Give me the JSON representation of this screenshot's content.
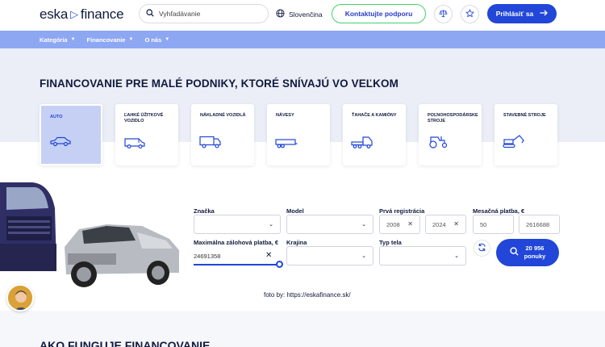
{
  "header": {
    "logo_left": "eska",
    "logo_right": "finance",
    "search_placeholder": "Vyhľadávanie",
    "language": "Slovenčina",
    "contact_label": "Kontaktujte podporu",
    "login_label": "Prihlásiť sa"
  },
  "nav": {
    "items": [
      {
        "label": "Kategória"
      },
      {
        "label": "Financovanie"
      },
      {
        "label": "O nás"
      }
    ]
  },
  "hero": {
    "title": "FINANCOVANIE PRE MALÉ PODNIKY, KTORÉ SNÍVAJÚ VO VEĽKOM",
    "categories": [
      {
        "label": "AUTO",
        "icon": "car-icon",
        "active": true
      },
      {
        "label": "ĽAHKÉ ÚŽITKOVÉ VOZIDLO",
        "icon": "van-icon"
      },
      {
        "label": "NÁKLADNÉ VOZIDLÁ",
        "icon": "truck-icon"
      },
      {
        "label": "NÁVESY",
        "icon": "trailer-icon"
      },
      {
        "label": "ŤAHAČE A KAMIÓNY",
        "icon": "tractor-unit-icon"
      },
      {
        "label": "POĽNOHOSPODÁRSKE STROJE",
        "icon": "tractor-icon"
      },
      {
        "label": "STAVEBNÉ STROJE",
        "icon": "excavator-icon"
      }
    ]
  },
  "filters": {
    "brand_label": "Značka",
    "model_label": "Model",
    "first_reg_label": "Prvá registrácia",
    "first_reg_from": "2008",
    "first_reg_to": "2024",
    "monthly_label": "Mesačná platba, €",
    "monthly_from": "50",
    "monthly_to": "2616688",
    "max_down_label": "Maximálna zálohová platba, €",
    "max_down_value": "24691358",
    "country_label": "Krajina",
    "body_label": "Typ tela",
    "results_count": "20 956",
    "results_unit": "ponuky"
  },
  "caption": "foto by: https://eskafinance.sk/",
  "section_title": "AKO FUNGUJE FINANCOVANIE",
  "colors": {
    "primary": "#2146d8",
    "nav": "#8ea7f2",
    "hero_bg": "#ebeef7",
    "contact_border": "#45d06a"
  }
}
